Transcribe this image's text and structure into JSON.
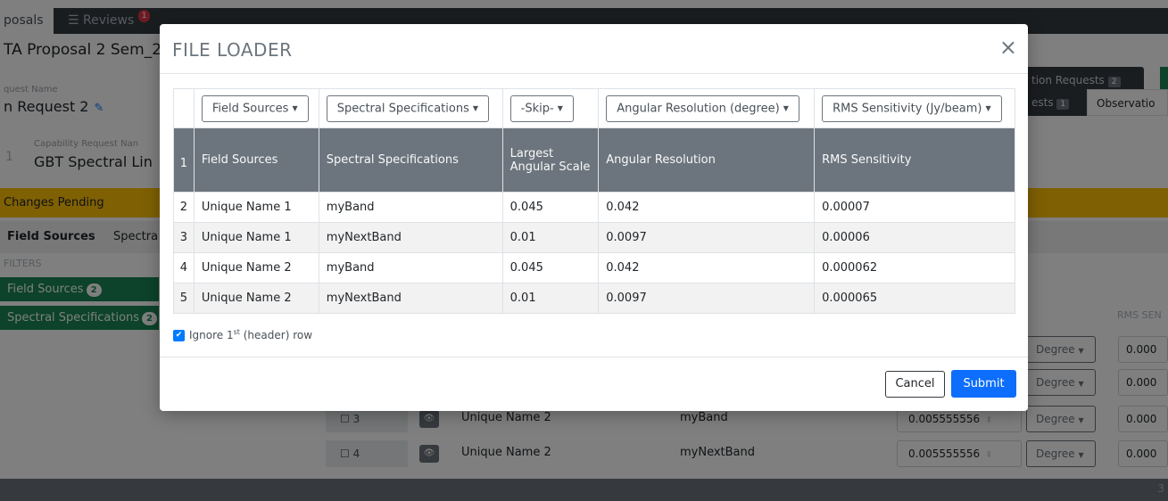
{
  "app": {
    "tab_proposals": "posals",
    "tab_reviews": "Reviews",
    "reviews_badge": "1",
    "proposal_title": "TA Proposal 2 Sem_2",
    "request_name_label": "quest Name",
    "request_name": "n Request 2",
    "capability_index": "1",
    "capability_label": "Capability Request Nan",
    "capability_value": "GBT Spectral Lin",
    "changes_pending": "Changes Pending",
    "subtab_field_sources": "Field Sources",
    "subtab_spectral": "Spectra",
    "filters_label": "FILTERS",
    "filter_field_sources": "Field Sources",
    "filter_field_sources_count": "2",
    "filter_spectral_specs": "Spectral Specifications",
    "filter_spectral_specs_count": "2",
    "right_button": "tion Requests",
    "right_button_count": "2",
    "right_tab1": "ests",
    "right_tab1_count": "1",
    "right_tab2": "Observatio",
    "rms_header": "RMS SEN",
    "rows": [
      {
        "checkbox": "☐ 3",
        "name": "Unique Name 2",
        "band": "myBand",
        "value": "0.005555556",
        "unit": "Degree",
        "rms": "0.000"
      },
      {
        "checkbox": "☐ 4",
        "name": "Unique Name 2",
        "band": "myNextBand",
        "value": "0.005555556",
        "unit": "Degree",
        "rms": "0.000"
      }
    ],
    "extra_degree_1": "Degree",
    "extra_degree_2": "Degree",
    "extra_rms_1": "0.000",
    "extra_rms_2": "0.000",
    "bottom_page": "3"
  },
  "modal": {
    "title": "FILE LOADER",
    "close_icon": "×",
    "selectors": [
      "Field Sources",
      "Spectral Specifications",
      "-Skip-",
      "Angular Resolution (degree)",
      "RMS Sensitivity (Jy/beam)"
    ],
    "header_index": "1",
    "headers": [
      "Field Sources",
      "Spectral Specifications",
      "Largest Angular Scale",
      "Angular Resolution",
      "RMS Sensitivity"
    ],
    "rows": [
      {
        "index": "2",
        "cells": [
          "Unique Name 1",
          "myBand",
          "0.045",
          "0.042",
          "0.00007"
        ]
      },
      {
        "index": "3",
        "cells": [
          "Unique Name 1",
          "myNextBand",
          "0.01",
          "0.0097",
          "0.00006"
        ]
      },
      {
        "index": "4",
        "cells": [
          "Unique Name 2",
          "myBand",
          "0.045",
          "0.042",
          "0.000062"
        ]
      },
      {
        "index": "5",
        "cells": [
          "Unique Name 2",
          "myNextBand",
          "0.01",
          "0.0097",
          "0.000065"
        ]
      }
    ],
    "ignore_text_pre": "Ignore 1",
    "ignore_sup": "st",
    "ignore_text_post": " (header) row",
    "cancel_label": "Cancel",
    "submit_label": "Submit"
  },
  "colors": {
    "primary": "#0d6efd",
    "success": "#198754",
    "warning": "#ffc107",
    "danger": "#dc3545",
    "header_gray": "#6c757d"
  },
  "icons": {
    "edit": "edit-icon",
    "eye": "eye-icon",
    "close": "close-icon",
    "caret": "caret-down-icon",
    "check": "check-icon",
    "list": "list-icon"
  }
}
